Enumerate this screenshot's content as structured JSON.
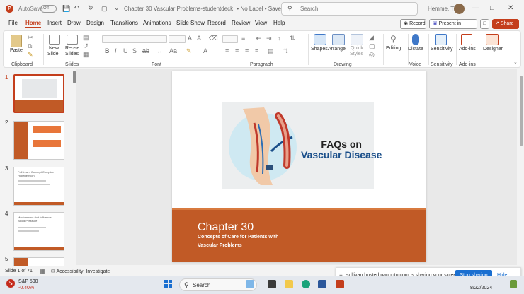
{
  "titlebar": {
    "autosave_label": "AutoSave",
    "autosave_state": "Off",
    "doc_title": "Chapter 30 Vascular Problems-studentdeck",
    "label_state": "No Label",
    "saved_state": "Saved",
    "search_placeholder": "Search",
    "user_name": "Hemme, Tia"
  },
  "tabs": [
    "File",
    "Home",
    "Insert",
    "Draw",
    "Design",
    "Transitions",
    "Animations",
    "Slide Show",
    "Record",
    "Review",
    "View",
    "Help"
  ],
  "active_tab": "Home",
  "actions": {
    "record": "Record",
    "present_teams": "Present in Teams",
    "share": "Share"
  },
  "ribbon": {
    "clipboard": {
      "paste": "Paste",
      "label": "Clipboard"
    },
    "slides": {
      "new_slide_1": "New",
      "new_slide_2": "Slide",
      "reuse_1": "Reuse",
      "reuse_2": "Slides",
      "label": "Slides"
    },
    "font": {
      "label": "Font"
    },
    "paragraph": {
      "label": "Paragraph"
    },
    "drawing": {
      "shapes": "Shapes",
      "arrange": "Arrange",
      "quick_styles_1": "Quick",
      "quick_styles_2": "Styles",
      "label": "Drawing"
    },
    "editing": {
      "label": "Editing"
    },
    "voice": {
      "dictate": "Dictate",
      "label": "Voice"
    },
    "sensitivity": {
      "button": "Sensitivity",
      "label": "Sensitivity"
    },
    "addins": {
      "button": "Add-ins",
      "label": "Add-ins"
    },
    "designer": {
      "button": "Designer"
    }
  },
  "thumbnails": [
    {
      "num": "1"
    },
    {
      "num": "2"
    },
    {
      "num": "3",
      "title": "Full Learn Concept Complex Hypertension"
    },
    {
      "num": "4",
      "title": "Mechanisms that Influence Blood Pressure"
    },
    {
      "num": "5"
    }
  ],
  "slide": {
    "headline_1": "FAQs on",
    "headline_2": "Vascular Disease",
    "chapter": "Chapter 30",
    "subtitle_1": "Concepts of Care for Patients with",
    "subtitle_2": "Vascular Problems"
  },
  "status": {
    "slide_counter": "Slide 1 of 71",
    "accessibility": "Accessibility: Investigate"
  },
  "sharing": {
    "message": "sullivan.hosted.panopto.com is sharing your screen.",
    "stop": "Stop sharing",
    "hide": "Hide"
  },
  "taskbar": {
    "stock_name": "S&P 500",
    "stock_change": "-0.40%",
    "search": "Search",
    "date": "8/22/2024"
  },
  "colors": {
    "accent": "#c43e1c",
    "slide_band": "#c15a26",
    "headline_blue": "#1b4f8a",
    "stop_button": "#1a6fd0"
  }
}
